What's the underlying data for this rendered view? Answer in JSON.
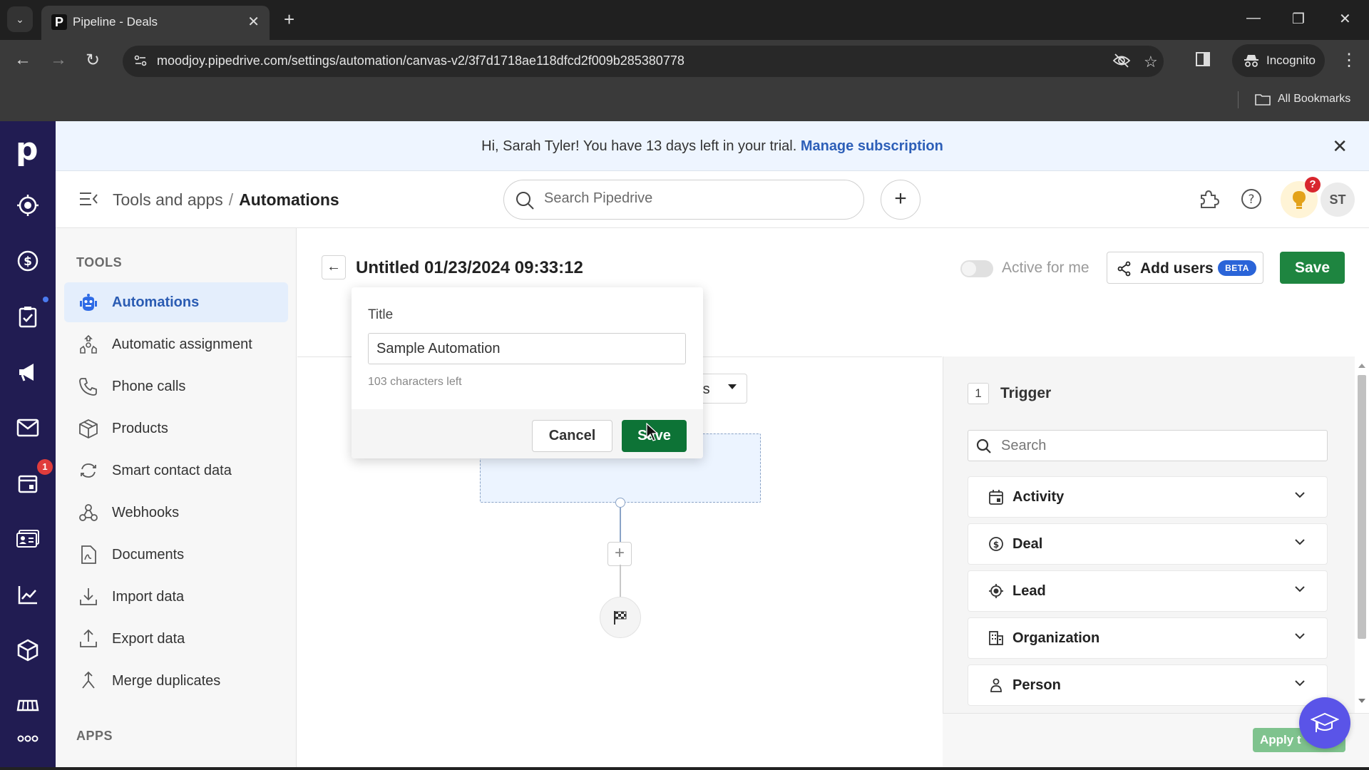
{
  "browser": {
    "tab_title": "Pipeline - Deals",
    "url": "moodjoy.pipedrive.com/settings/automation/canvas-v2/3f7d1718ae118dfcd2f009b285380778",
    "incognito_label": "Incognito",
    "bookmarks_label": "All Bookmarks"
  },
  "banner": {
    "message": "Hi, Sarah Tyler! You have 13 days left in your trial. ",
    "link": "Manage subscription"
  },
  "header": {
    "breadcrumb_parent": "Tools and apps",
    "breadcrumb_separator": "/",
    "breadcrumb_current": "Automations",
    "search_placeholder": "Search Pipedrive",
    "notification_badge": "?",
    "avatar_initials": "ST"
  },
  "rail": {
    "calendar_badge": "1"
  },
  "sidebar": {
    "tools_heading": "TOOLS",
    "apps_heading": "APPS",
    "items": [
      {
        "label": "Automations",
        "icon": "robot-icon",
        "active": true
      },
      {
        "label": "Automatic assignment",
        "icon": "assignment-icon"
      },
      {
        "label": "Phone calls",
        "icon": "phone-icon"
      },
      {
        "label": "Products",
        "icon": "box-icon"
      },
      {
        "label": "Smart contact data",
        "icon": "sync-icon"
      },
      {
        "label": "Webhooks",
        "icon": "webhook-icon"
      },
      {
        "label": "Documents",
        "icon": "document-icon"
      },
      {
        "label": "Import data",
        "icon": "import-icon"
      },
      {
        "label": "Export data",
        "icon": "export-icon"
      },
      {
        "label": "Merge duplicates",
        "icon": "merge-icon"
      }
    ]
  },
  "automation": {
    "title": "Untitled 01/23/2024 09:33:12",
    "active_label": "Active for me",
    "active": false,
    "add_users_label": "Add users",
    "beta_label": "BETA",
    "save_label": "Save",
    "filter_partial": "rs"
  },
  "popover": {
    "field_label": "Title",
    "field_value": "Sample Automation",
    "chars_left": "103 characters left",
    "cancel_label": "Cancel",
    "save_label": "Save"
  },
  "trigger_panel": {
    "step_number": "1",
    "step_title": "Trigger",
    "search_placeholder": "Search",
    "categories": [
      {
        "label": "Activity",
        "icon": "calendar-icon"
      },
      {
        "label": "Deal",
        "icon": "dollar-icon"
      },
      {
        "label": "Lead",
        "icon": "target-icon"
      },
      {
        "label": "Organization",
        "icon": "building-icon"
      },
      {
        "label": "Person",
        "icon": "person-icon"
      }
    ],
    "apply_label": "Apply t"
  }
}
